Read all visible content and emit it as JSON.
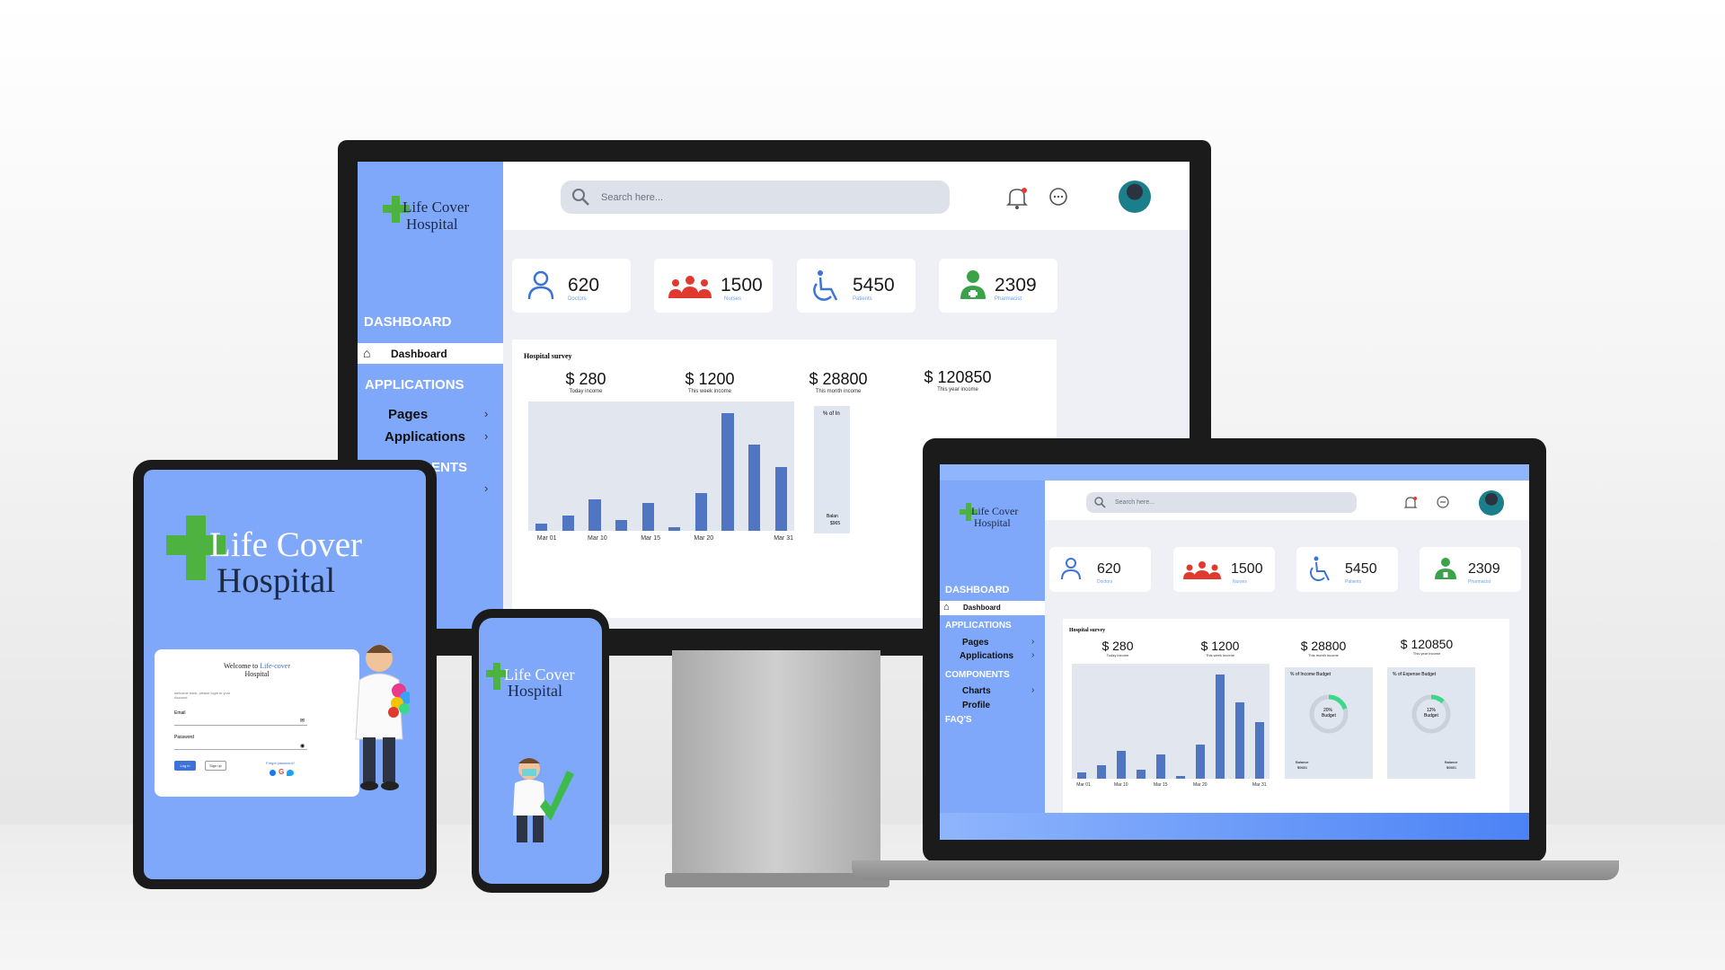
{
  "brand": {
    "line1": "Life Cover",
    "line2": "Hospital"
  },
  "search": {
    "placeholder": "Search here..."
  },
  "sidebar": {
    "dashboard_heading": "DASHBOARD",
    "dashboard_item": "Dashboard",
    "applications_heading": "APPLICATIONS",
    "pages": "Pages",
    "applications": "Applications",
    "components_heading": "COMPONENTS",
    "components_partial": "ENTS",
    "charts": "Charts",
    "profile": "Profile",
    "faqs": "FAQ'S"
  },
  "stats": [
    {
      "value": "620",
      "label": "Doctors"
    },
    {
      "value": "1500",
      "label": "Nurses"
    },
    {
      "value": "5450",
      "label": "Patients"
    },
    {
      "value": "2309",
      "label": "Pharmacist"
    }
  ],
  "survey": {
    "title": "Hospital survey",
    "incomes": [
      {
        "value": "$ 280",
        "label": "Today income"
      },
      {
        "value": "$ 1200",
        "label": "This week income"
      },
      {
        "value": "$ 28800",
        "label": "This month income"
      },
      {
        "value": "$ 120850",
        "label": "This year income"
      }
    ]
  },
  "chart_data": {
    "type": "bar",
    "categories": [
      "b1",
      "b2",
      "b3",
      "b4",
      "b5",
      "b6",
      "b7",
      "b8",
      "b9",
      "b10"
    ],
    "values": [
      4,
      9,
      18,
      6,
      16,
      2,
      22,
      68,
      50,
      37
    ],
    "x_ticks": [
      "Mar 01",
      "Mar 10",
      "Mar 15",
      "Mar 20",
      "Mar 31"
    ],
    "ylim": [
      0,
      75
    ]
  },
  "budgets": [
    {
      "title": "% of Income Budget",
      "pct": "20%",
      "center": "Budget",
      "legend": "Balance",
      "amount": "$9651"
    },
    {
      "title": "% of Expense Budget",
      "pct": "12%",
      "center": "Budget",
      "legend": "Balance",
      "amount": "$9651"
    }
  ],
  "budget_fills": [
    0.2,
    0.12
  ],
  "monitor_partial": {
    "budget_title": "% of In",
    "legend": "Balan",
    "amount": "$965"
  },
  "login": {
    "welcome_prefix": "Welcome to ",
    "welcome_brand": "Life-cover",
    "welcome_suffix": "Hospital",
    "subtitle": "welcome back, please login to your Account",
    "email_label": "Email",
    "password_label": "Password",
    "login_button": "Log in",
    "signup_button": "Sign up",
    "forgot": "Forgot password?"
  },
  "colors": {
    "sidebar": "#7fa8fb",
    "accent": "#4db23f",
    "bar": "#5076c3"
  }
}
